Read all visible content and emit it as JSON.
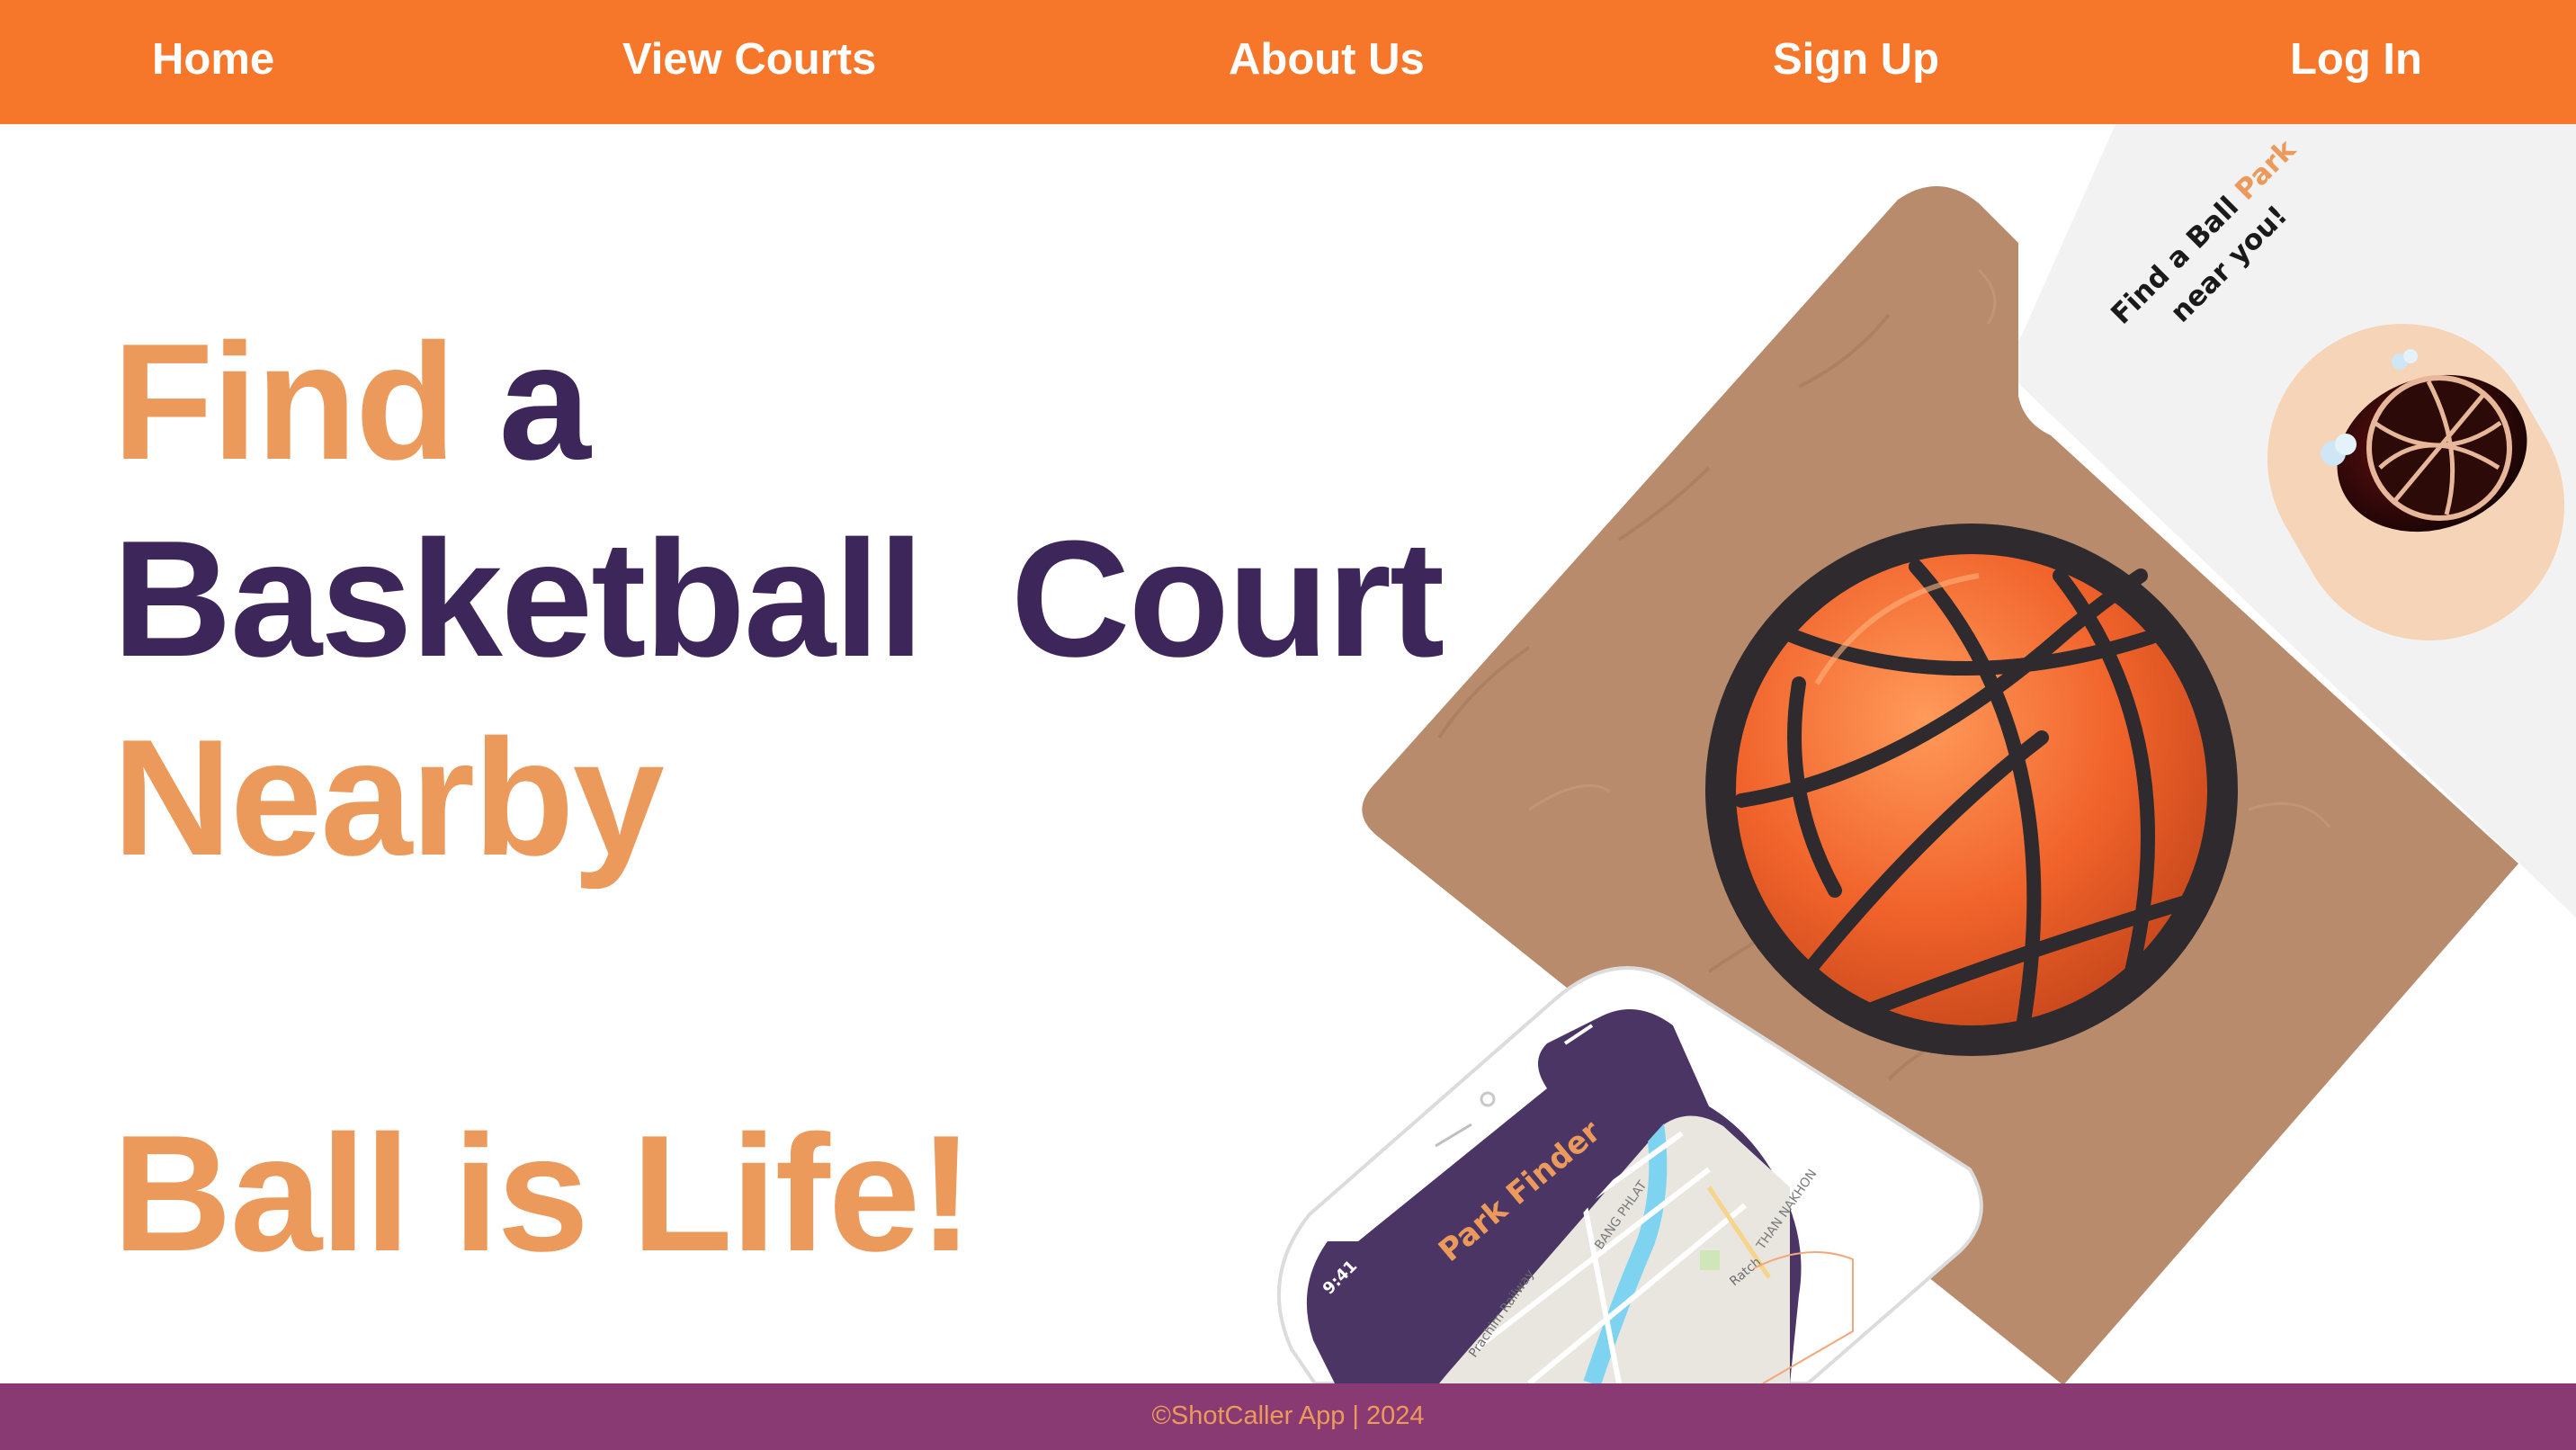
{
  "nav": {
    "items": [
      {
        "label": "Home"
      },
      {
        "label": "View Courts"
      },
      {
        "label": "About Us"
      },
      {
        "label": "Sign Up"
      },
      {
        "label": "Log In"
      }
    ]
  },
  "hero": {
    "line1_word1": "Find",
    "line1_word2": "a",
    "line2": "Basketball  Court",
    "line3": "Nearby",
    "tagline": "Ball is Life!"
  },
  "promo_card": {
    "line1_prefix": "Find a Ball ",
    "line1_highlight": "Park",
    "line2": "near you!"
  },
  "phone": {
    "time": "9:41",
    "app_title": "Park Finder",
    "map_labels": [
      "Prachim Railway",
      "BANG PHLAT",
      "THAN NAKHON",
      "Ratch"
    ]
  },
  "footer": {
    "copyright": "©ShotCaller App | 2024"
  },
  "colors": {
    "nav_bg": "#f6762a",
    "accent_orange": "#ec9a5b",
    "accent_purple": "#3d2659",
    "footer_bg": "#893a72",
    "phone_header": "#4a3564"
  }
}
